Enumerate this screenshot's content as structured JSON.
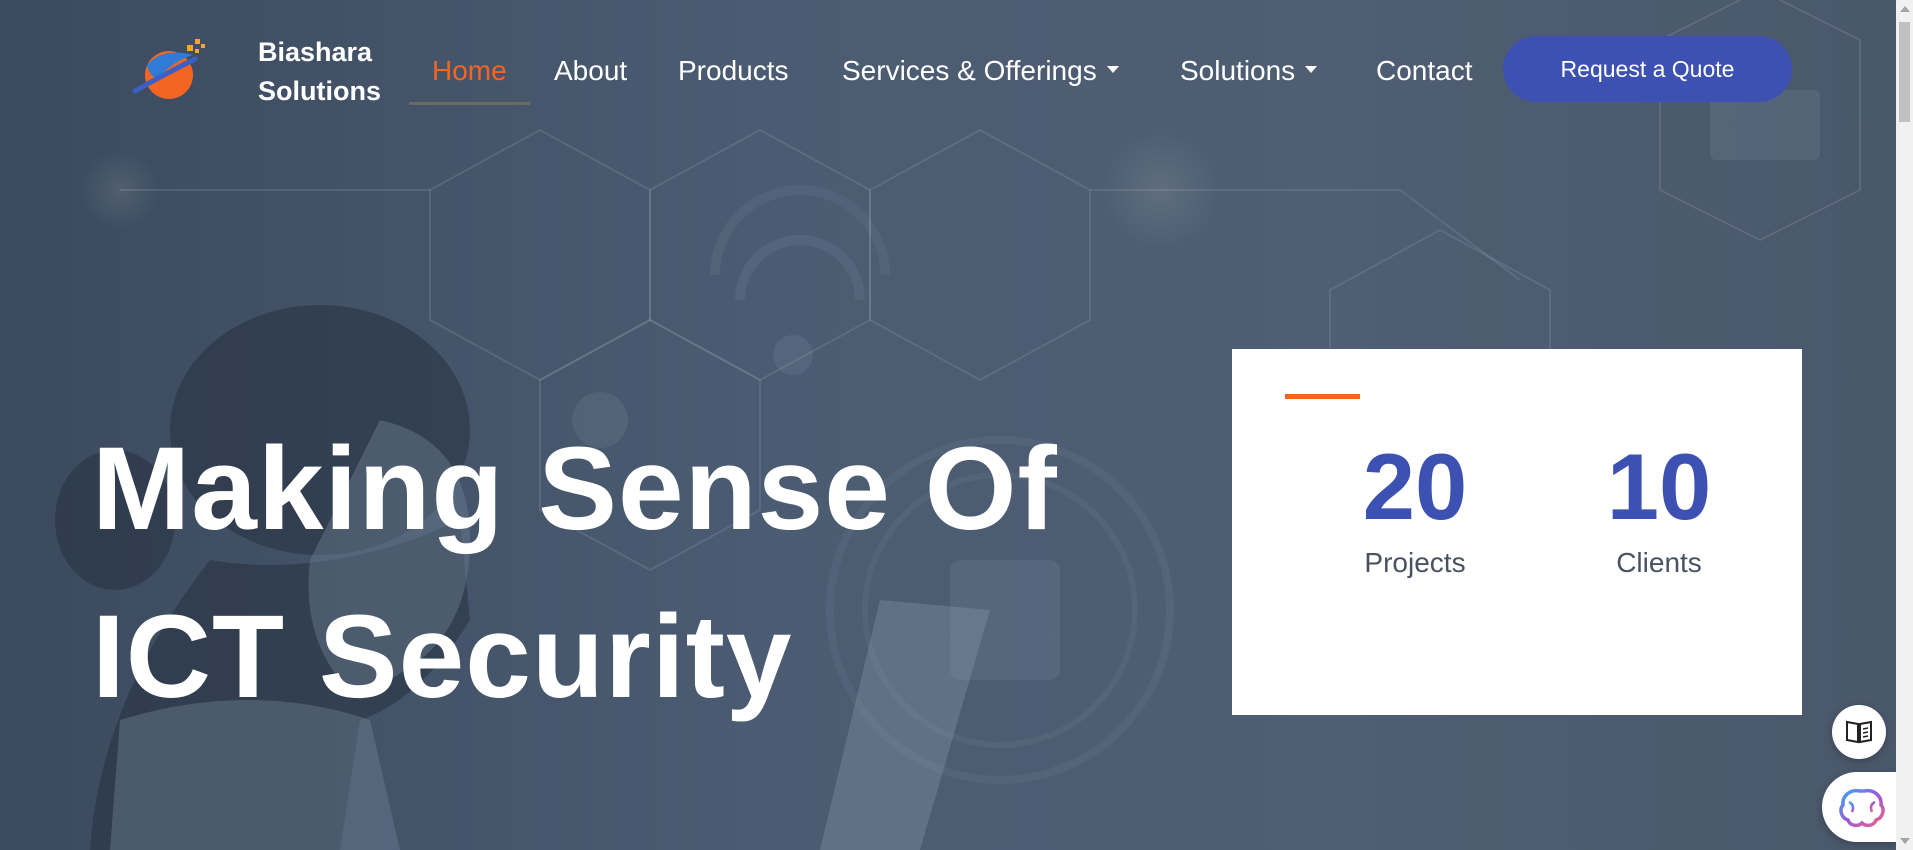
{
  "brand": {
    "line1": "Biashara",
    "line2": "Solutions",
    "logo_icon": "planet-logo-icon"
  },
  "nav": {
    "items": [
      {
        "label": "Home",
        "active": true
      },
      {
        "label": "About"
      },
      {
        "label": "Products"
      },
      {
        "label": "Services & Offerings",
        "dropdown": true
      },
      {
        "label": "Solutions",
        "dropdown": true
      },
      {
        "label": "Contact"
      }
    ],
    "cta_label": "Request a Quote"
  },
  "hero": {
    "headline_line1": "Making Sense Of",
    "headline_line2": "ICT Security"
  },
  "stats": [
    {
      "value": "20",
      "label": "Projects"
    },
    {
      "value": "10",
      "label": "Clients"
    }
  ],
  "floating": {
    "reader_icon": "book-reader-icon",
    "ai_icon": "brain-icon"
  },
  "colors": {
    "accent_orange": "#f26522",
    "brand_blue": "#3d51b3"
  }
}
